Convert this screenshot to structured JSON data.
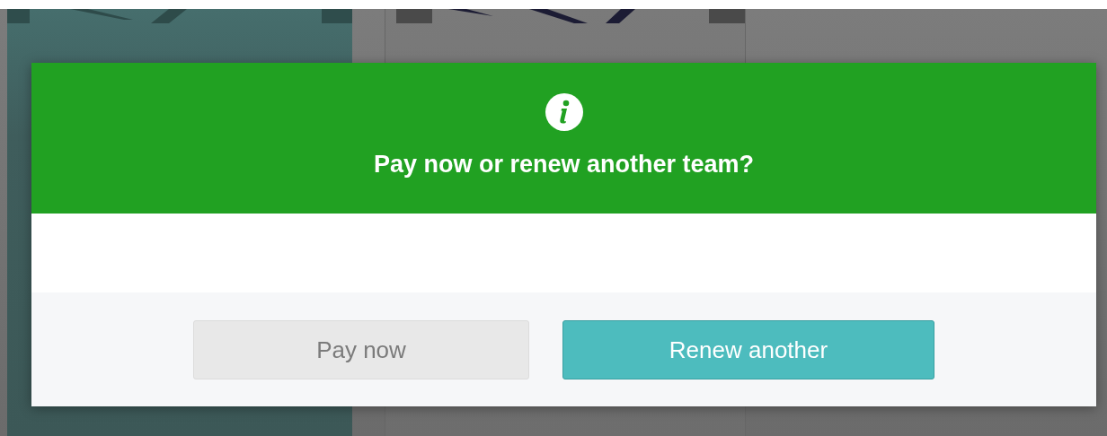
{
  "dialog": {
    "title": "Pay now or renew another team?",
    "buttons": [
      {
        "label": "Pay now",
        "kind": "secondary"
      },
      {
        "label": "Renew another",
        "kind": "primary"
      }
    ]
  }
}
